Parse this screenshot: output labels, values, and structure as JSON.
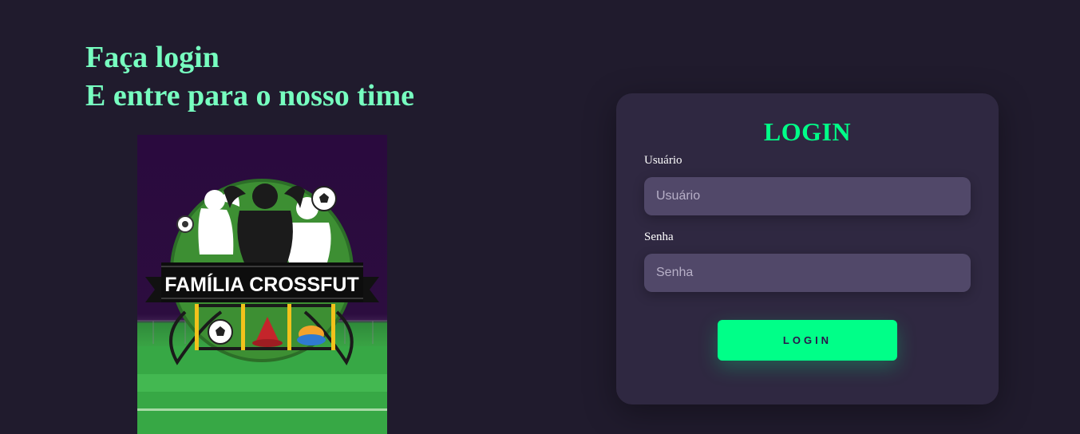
{
  "hero": {
    "line1": "Faça login",
    "line2": "E entre para o nosso time"
  },
  "poster": {
    "brand_text": "FAMÍLIA CROSSFUT",
    "image_description_icon": "crossfut-team-logo"
  },
  "login_card": {
    "title": "LOGIN",
    "username_label": "Usuário",
    "username_placeholder": "Usuário",
    "username_value": "",
    "password_label": "Senha",
    "password_placeholder": "Senha",
    "password_value": "",
    "submit_label": "LOGIN"
  },
  "colors": {
    "background": "#201b2d",
    "card": "#2f2841",
    "input": "#514869",
    "accent": "#00ff88",
    "headline": "#77ffc0"
  }
}
